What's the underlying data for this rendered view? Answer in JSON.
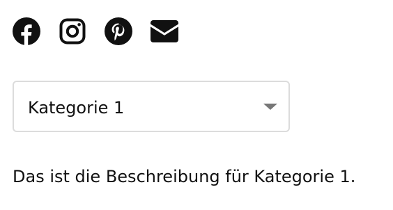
{
  "social": {
    "items": [
      {
        "name": "Facebook",
        "icon": "facebook-icon"
      },
      {
        "name": "Instagram",
        "icon": "instagram-icon"
      },
      {
        "name": "Pinterest",
        "icon": "pinterest-icon"
      },
      {
        "name": "E-Mail",
        "icon": "email-icon"
      }
    ],
    "icon_color": "#111111"
  },
  "category_select": {
    "selected_value": "Kategorie 1",
    "caret_icon": "caret-down-icon",
    "border_color": "#dcdcdc",
    "caret_color": "#777777"
  },
  "description": {
    "text": "Das ist die Beschreibung für Kategorie 1."
  }
}
